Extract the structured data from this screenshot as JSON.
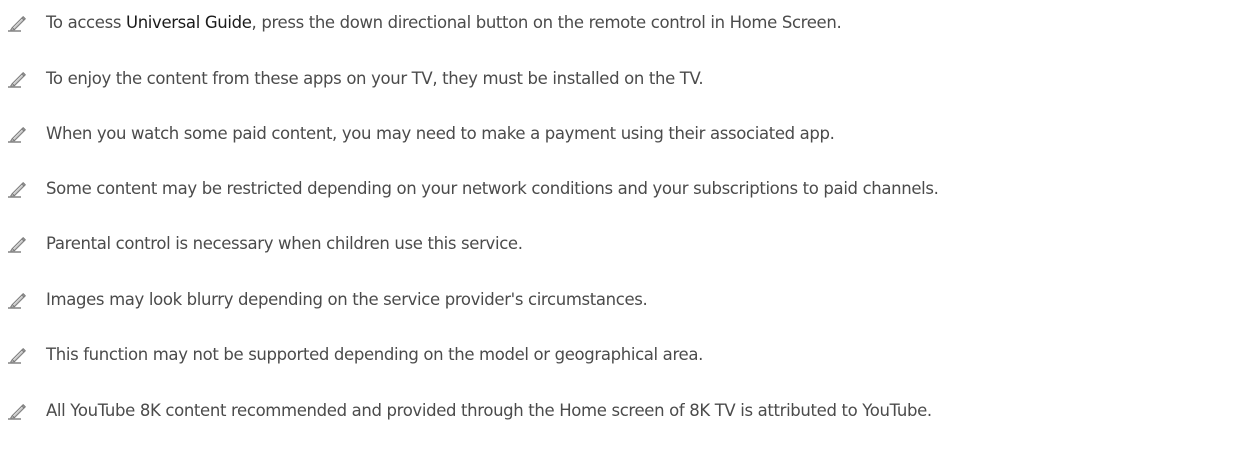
{
  "notes": [
    {
      "icon": "pencil-icon",
      "text_before": "To access ",
      "highlight": "Universal Guide",
      "text_after": ", press the down directional button on the remote control in Home Screen."
    },
    {
      "icon": "pencil-icon",
      "text": "To enjoy the content from these apps on your TV, they must be installed on the TV."
    },
    {
      "icon": "pencil-icon",
      "text": "When you watch some paid content, you may need to make a payment using their associated app."
    },
    {
      "icon": "pencil-icon",
      "text": "Some content may be restricted depending on your network conditions and your subscriptions to paid channels."
    },
    {
      "icon": "pencil-icon",
      "text": "Parental control is necessary when children use this service."
    },
    {
      "icon": "pencil-icon",
      "text": "Images may look blurry depending on the service provider's circumstances."
    },
    {
      "icon": "pencil-icon",
      "text": "This function may not be supported depending on the model or geographical area."
    },
    {
      "icon": "pencil-icon",
      "text": "All YouTube 8K content recommended and provided through the Home screen of 8K TV is attributed to YouTube."
    }
  ],
  "colors": {
    "text": "#4b4b4b",
    "highlight": "#1a1a1a",
    "icon": "#8a8a8a"
  }
}
